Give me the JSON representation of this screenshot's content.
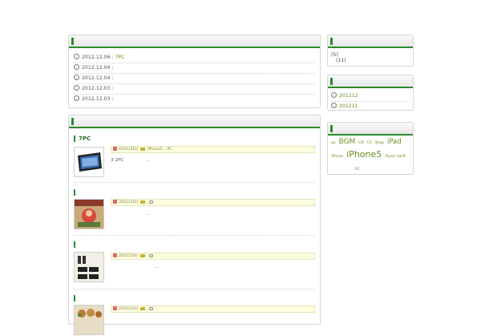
{
  "news": {
    "rows": [
      {
        "date": "2012.12.06 :",
        "title": "7PC"
      },
      {
        "date": "2012.12.04 :",
        "title": ""
      },
      {
        "date": "2012.12.04 :",
        "title": ""
      },
      {
        "date": "2012.12.03 :",
        "title": ""
      },
      {
        "date": "2012.12.03 :",
        "title": ""
      }
    ]
  },
  "posts": [
    {
      "title": "7PC",
      "date": "2012126()",
      "cats": "iPhone5... PC",
      "excerpt_left": "3 2PC",
      "excerpt_right": "..."
    },
    {
      "title": "",
      "date": "2012124()",
      "cats": "",
      "excerpt_left": "",
      "excerpt_right": "..."
    },
    {
      "title": "",
      "date": "2012124()",
      "cats": "..",
      "excerpt_left": "",
      "excerpt_right": "..."
    },
    {
      "title": "",
      "date": "2012123()",
      "cats": "..",
      "excerpt_left": "",
      "excerpt_right": ""
    }
  ],
  "sidebar": {
    "categories": {
      "line1": "(5)",
      "line2": "(11)"
    },
    "archives": [
      "201212",
      "201211"
    ],
    "tags": [
      "au",
      "BGM",
      "CD",
      "CS",
      "Shop",
      "iPad",
      "iPhone",
      "iPhone5",
      "Taylor Swift",
      "PC"
    ]
  }
}
